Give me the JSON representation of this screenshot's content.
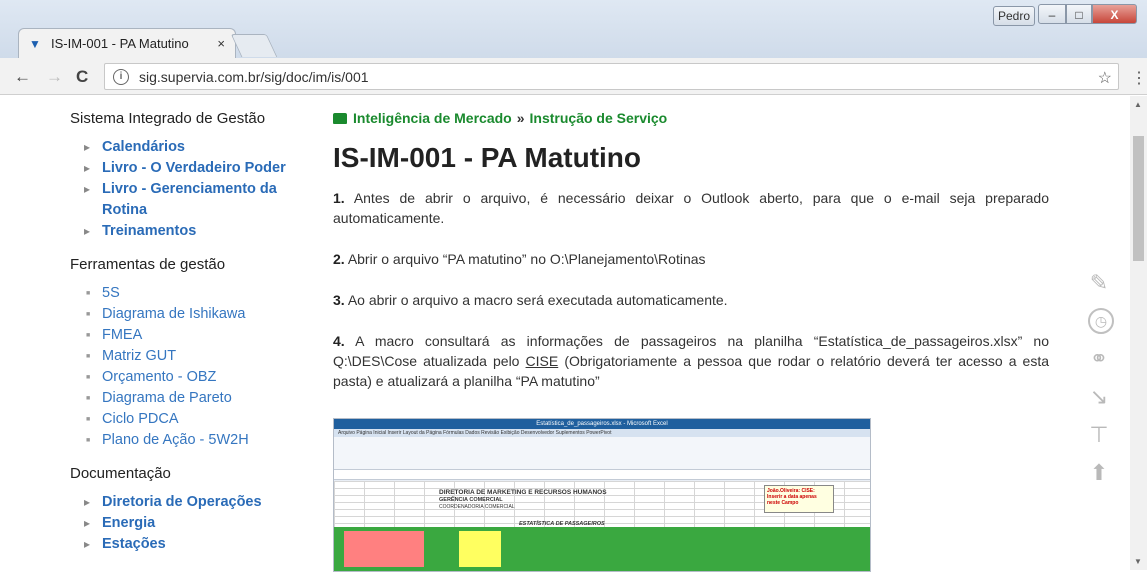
{
  "browser": {
    "tab_title": "IS-IM-001 - PA Matutino",
    "tab_close": "×",
    "user": "Pedro",
    "url": "sig.supervia.com.br/sig/doc/im/is/001",
    "back": "←",
    "forward": "→",
    "reload": "C",
    "star": "☆",
    "menu": "⋮",
    "min": "–",
    "max": "□",
    "close": "X"
  },
  "sidebar": {
    "section1": {
      "heading": "Sistema Integrado de Gestão",
      "items": [
        "Calendários",
        "Livro - O Verdadeiro Poder",
        "Livro - Gerenciamento da Rotina",
        "Treinamentos"
      ]
    },
    "section2": {
      "heading": "Ferramentas de gestão",
      "items": [
        "5S",
        "Diagrama de Ishikawa",
        "FMEA",
        "Matriz GUT",
        "Orçamento - OBZ",
        "Diagrama de Pareto",
        "Ciclo PDCA",
        "Plano de Ação - 5W2H"
      ]
    },
    "section3": {
      "heading": "Documentação",
      "items": [
        "Diretoria de Operações",
        "Energia",
        "Estações"
      ]
    }
  },
  "main": {
    "breadcrumb": {
      "part1": "Inteligência de Mercado",
      "sep": "»",
      "part2": "Instrução de Serviço"
    },
    "title": "IS-IM-001 - PA Matutino",
    "steps": [
      {
        "num": "1.",
        "text": "Antes de abrir o arquivo, é necessário deixar o Outlook aberto, para que o e-mail seja preparado automaticamente."
      },
      {
        "num": "2.",
        "text": "Abrir o arquivo “PA matutino” no O:\\Planejamento\\Rotinas"
      },
      {
        "num": "3.",
        "text": "Ao abrir o arquivo a macro será executada automaticamente."
      },
      {
        "num": "4.",
        "text_a": "A macro consultará as informações de passageiros na planilha “Estatística_de_passageiros.xlsx” no Q:\\DES\\Cose atualizada pelo",
        "cise": "CISE",
        "text_b": "(Obrigatoriamente a pessoa que rodar o relatório deverá ter acesso a esta pasta) e atualizará a planilha “PA matutino”"
      }
    ]
  },
  "screenshot": {
    "window_title": "Estatística_de_passageiros.xlsx - Microsoft Excel",
    "ribbon_tabs": "Arquivo   Página Inicial   Inserir   Layout da Página   Fórmulas   Dados   Revisão   Exibição   Desenvolvedor   Suplementos   PowerPivot",
    "header1": "DIRETORIA DE MARKETING E RECURSOS HUMANOS",
    "header2": "GERÊNCIA COMERCIAL",
    "header3": "COORDENADORIA COMERCIAL",
    "caption": "ESTATÍSTICA DE PASSAGEIROS",
    "note": "João.Oliveira: CISE: Inserir a data apenas neste Campo"
  },
  "side_tools": {
    "pencil": "✎",
    "clock": "◷",
    "link": "⚭",
    "cursor": "↘",
    "roller": "⊤",
    "up": "⬆"
  }
}
